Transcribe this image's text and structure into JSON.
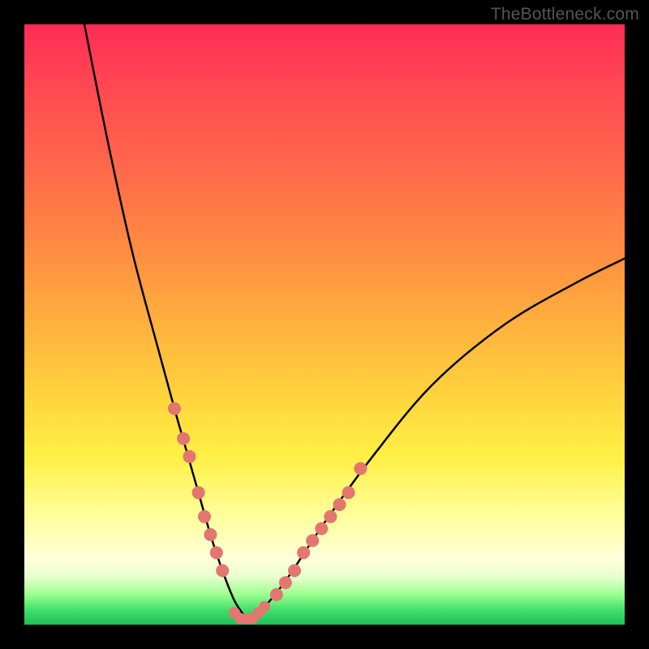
{
  "watermark": "TheBottleneck.com",
  "chart_data": {
    "type": "line",
    "title": "",
    "xlabel": "",
    "ylabel": "",
    "xlim": [
      0,
      100
    ],
    "ylim": [
      0,
      100
    ],
    "grid": false,
    "legend": false,
    "background_gradient": {
      "stops": [
        {
          "pos": 0.0,
          "color": "#ff2c57"
        },
        {
          "pos": 0.1,
          "color": "#ff4752"
        },
        {
          "pos": 0.25,
          "color": "#ff6b4a"
        },
        {
          "pos": 0.38,
          "color": "#ff8d42"
        },
        {
          "pos": 0.5,
          "color": "#ffb13e"
        },
        {
          "pos": 0.62,
          "color": "#ffd43d"
        },
        {
          "pos": 0.72,
          "color": "#fff045"
        },
        {
          "pos": 0.82,
          "color": "#ffff9c"
        },
        {
          "pos": 0.89,
          "color": "#ffffda"
        },
        {
          "pos": 0.92,
          "color": "#e7ffce"
        },
        {
          "pos": 0.95,
          "color": "#9cff8e"
        },
        {
          "pos": 0.975,
          "color": "#41e06b"
        },
        {
          "pos": 1.0,
          "color": "#1fbf58"
        }
      ]
    },
    "series": [
      {
        "name": "bottleneck-curve-left",
        "stroke": "#000000",
        "stroke_width": 2.5,
        "x": [
          10,
          14,
          18,
          22,
          25,
          27,
          29,
          31,
          33,
          35,
          37
        ],
        "y": [
          100,
          80,
          62,
          47,
          36,
          29,
          22,
          15,
          9,
          4,
          1
        ]
      },
      {
        "name": "bottleneck-curve-right",
        "stroke": "#000000",
        "stroke_width": 2.5,
        "x": [
          37,
          40,
          44,
          50,
          58,
          68,
          80,
          92,
          100
        ],
        "y": [
          1,
          3,
          8,
          17,
          28,
          40,
          50,
          57,
          61
        ]
      },
      {
        "name": "marker-cluster-left",
        "type": "scatter",
        "marker_color": "#e3766f",
        "marker_radius": 8,
        "x": [
          25,
          26.5,
          27.5,
          29,
          30,
          31,
          32,
          33
        ],
        "y": [
          36,
          31,
          28,
          22,
          18,
          15,
          12,
          9
        ]
      },
      {
        "name": "marker-cluster-right",
        "type": "scatter",
        "marker_color": "#e3766f",
        "marker_radius": 8,
        "x": [
          42,
          43.5,
          45,
          46.5,
          48,
          49.5,
          51,
          52.5,
          54,
          56
        ],
        "y": [
          5,
          7,
          9,
          12,
          14,
          16,
          18,
          20,
          22,
          26
        ]
      },
      {
        "name": "marker-cluster-bottom",
        "type": "scatter",
        "marker_color": "#e3766f",
        "marker_radius": 7,
        "x": [
          35,
          36,
          37,
          38,
          39,
          40
        ],
        "y": [
          2,
          1,
          1,
          1,
          2,
          3
        ]
      }
    ]
  }
}
